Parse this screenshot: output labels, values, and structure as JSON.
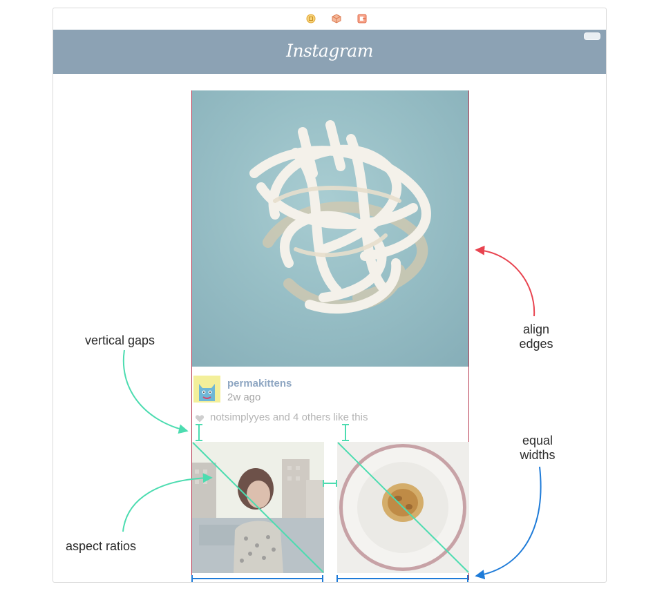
{
  "navbar": {
    "title": "Instagram"
  },
  "dock": {
    "icons": [
      "view-controller-icon",
      "first-responder-icon",
      "exit-icon"
    ]
  },
  "post": {
    "username": "permakittens",
    "time_ago": "2w ago",
    "likes_text": "notsimplyyes and 4 others like this"
  },
  "annotations": {
    "vertical_gaps": "vertical gaps",
    "aspect_ratios": "aspect ratios",
    "align_edges_line1": "align",
    "align_edges_line2": "edges",
    "equal_widths_line1": "equal",
    "equal_widths_line2": "widths"
  },
  "colors": {
    "navbar": "#8ca2b4",
    "username": "#8ea6c2",
    "align_arrow": "#e8434f",
    "gap_arrow": "#4cdcb0",
    "width_arrow": "#1e7bd8",
    "cell_border": "#b83a52"
  }
}
